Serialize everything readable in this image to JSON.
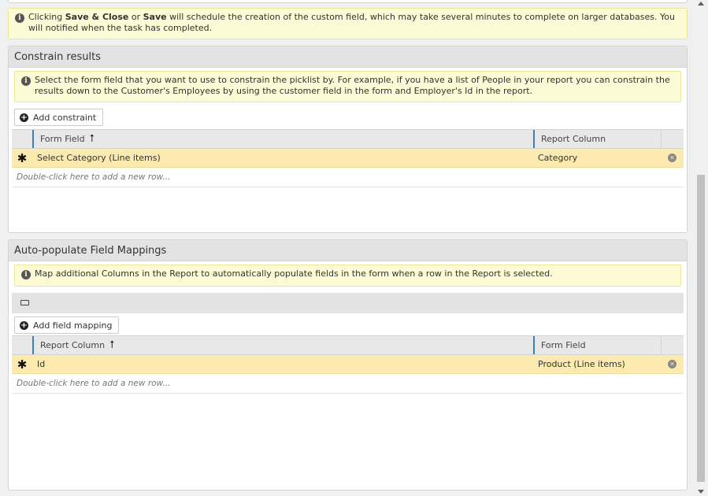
{
  "notice": {
    "prefix": "Clicking ",
    "save_close": "Save & Close",
    "or": " or ",
    "save": "Save",
    "suffix": " will schedule the creation of the custom field, which may take several minutes to complete on larger databases. You will notified when the task has completed."
  },
  "constrain": {
    "title": "Constrain results",
    "info": "Select the form field that you want to use to constrain the picklist by. For example, if you have a list of People in your report you can constrain the results down to the Customer's Employees by using the customer field in the form and Employer's Id in the report.",
    "add_button": "Add constraint",
    "columns": [
      "Form Field",
      "Report Column"
    ],
    "sort_arrow": "⭡",
    "rows": [
      {
        "marker": "✱",
        "form_field": "Select Category (Line items)",
        "report_column": "Category"
      }
    ],
    "new_row_hint": "Double-click here to add a new row..."
  },
  "autopopulate": {
    "title": "Auto-populate Field Mappings",
    "info": "Map additional Columns in the Report to automatically populate fields in the form when a row in the Report is selected.",
    "add_button": "Add field mapping",
    "columns": [
      "Report Column",
      "Form Field"
    ],
    "sort_arrow": "⭡",
    "rows": [
      {
        "marker": "✱",
        "report_column": "Id",
        "form_field": "Product (Line items)"
      }
    ],
    "new_row_hint": "Double-click here to add a new row..."
  },
  "icons": {
    "info": "info-icon",
    "add": "plus-circle-icon",
    "remove": "remove-circle-icon",
    "collapse": "collapse-icon"
  }
}
